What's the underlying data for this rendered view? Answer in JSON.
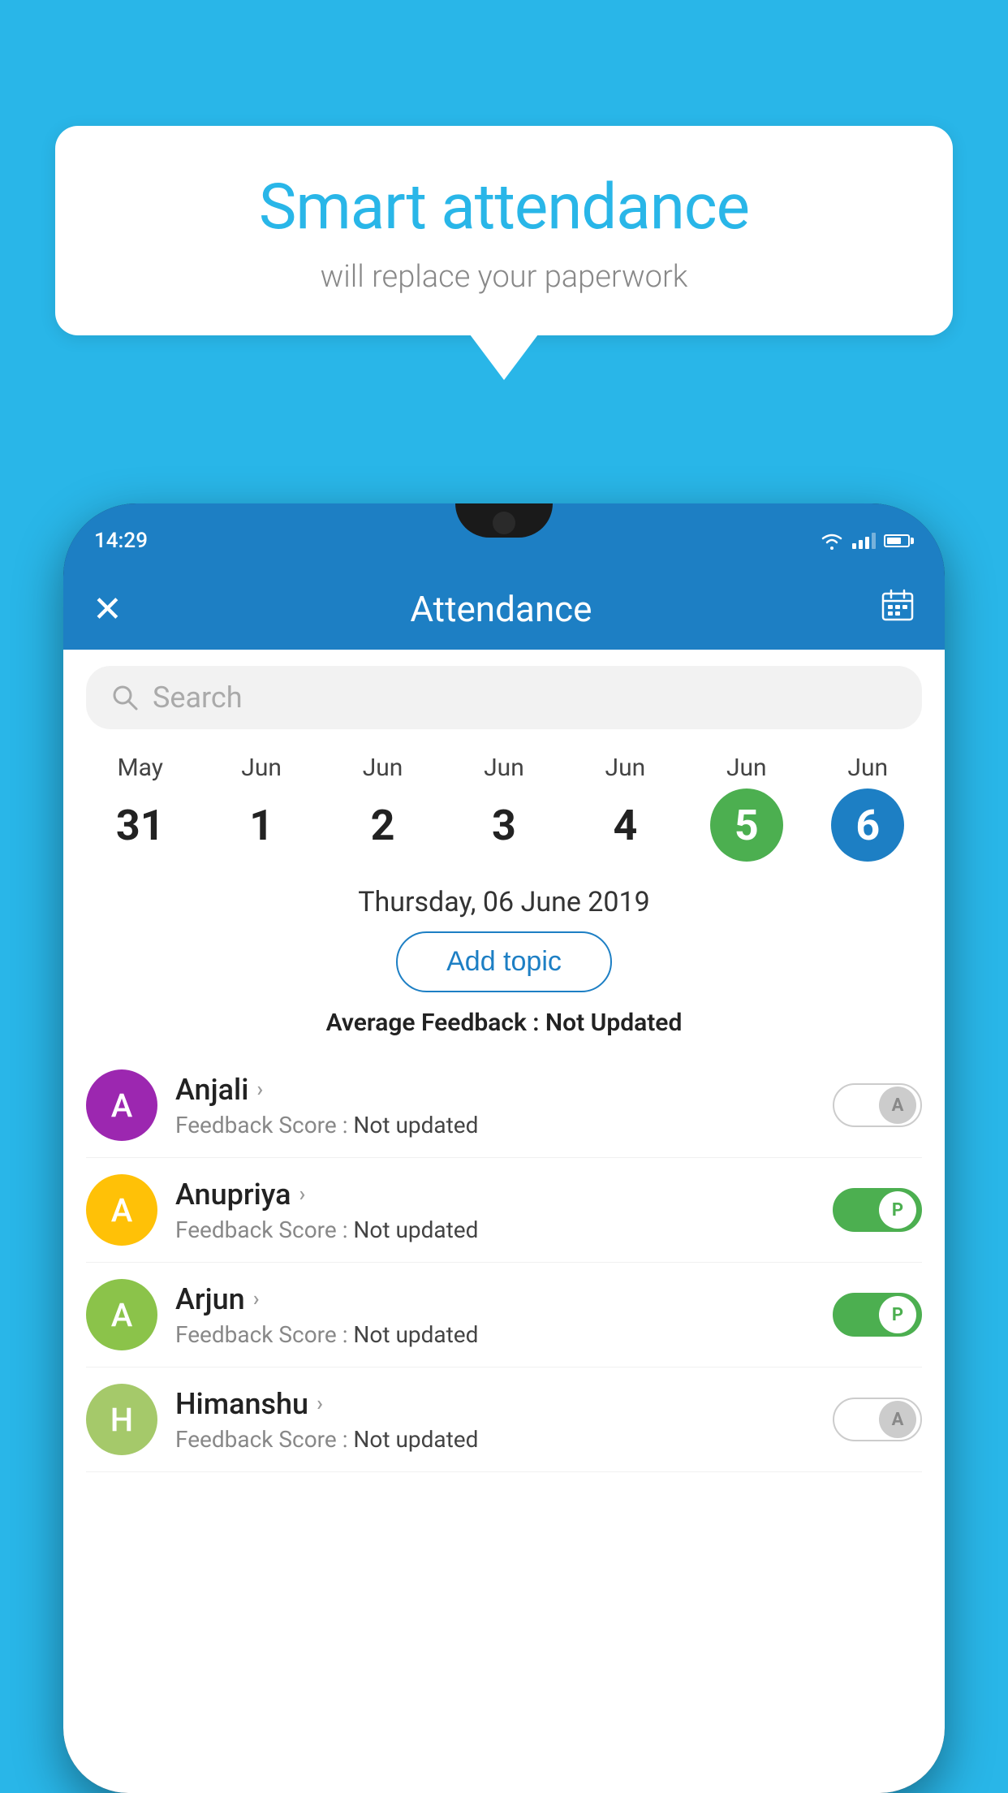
{
  "background_color": "#29b6e8",
  "speech_bubble": {
    "title": "Smart attendance",
    "subtitle": "will replace your paperwork"
  },
  "status_bar": {
    "time": "14:29"
  },
  "app_header": {
    "title": "Attendance",
    "close_label": "×",
    "calendar_label": "📅"
  },
  "search": {
    "placeholder": "Search"
  },
  "calendar": {
    "days": [
      {
        "month": "May",
        "date": "31",
        "style": "normal"
      },
      {
        "month": "Jun",
        "date": "1",
        "style": "normal"
      },
      {
        "month": "Jun",
        "date": "2",
        "style": "normal"
      },
      {
        "month": "Jun",
        "date": "3",
        "style": "normal"
      },
      {
        "month": "Jun",
        "date": "4",
        "style": "normal"
      },
      {
        "month": "Jun",
        "date": "5",
        "style": "today"
      },
      {
        "month": "Jun",
        "date": "6",
        "style": "selected"
      }
    ]
  },
  "selected_date": "Thursday, 06 June 2019",
  "add_topic_label": "Add topic",
  "average_feedback": {
    "label": "Average Feedback : ",
    "value": "Not Updated"
  },
  "students": [
    {
      "name": "Anjali",
      "avatar_letter": "A",
      "avatar_color": "#9c27b0",
      "feedback_label": "Feedback Score : ",
      "feedback_value": "Not updated",
      "toggle_state": "off",
      "toggle_label": "A"
    },
    {
      "name": "Anupriya",
      "avatar_letter": "A",
      "avatar_color": "#ffc107",
      "feedback_label": "Feedback Score : ",
      "feedback_value": "Not updated",
      "toggle_state": "on",
      "toggle_label": "P"
    },
    {
      "name": "Arjun",
      "avatar_letter": "A",
      "avatar_color": "#8bc34a",
      "feedback_label": "Feedback Score : ",
      "feedback_value": "Not updated",
      "toggle_state": "on",
      "toggle_label": "P"
    },
    {
      "name": "Himanshu",
      "avatar_letter": "H",
      "avatar_color": "#a5c96a",
      "feedback_label": "Feedback Score : ",
      "feedback_value": "Not updated",
      "toggle_state": "off",
      "toggle_label": "A"
    }
  ]
}
